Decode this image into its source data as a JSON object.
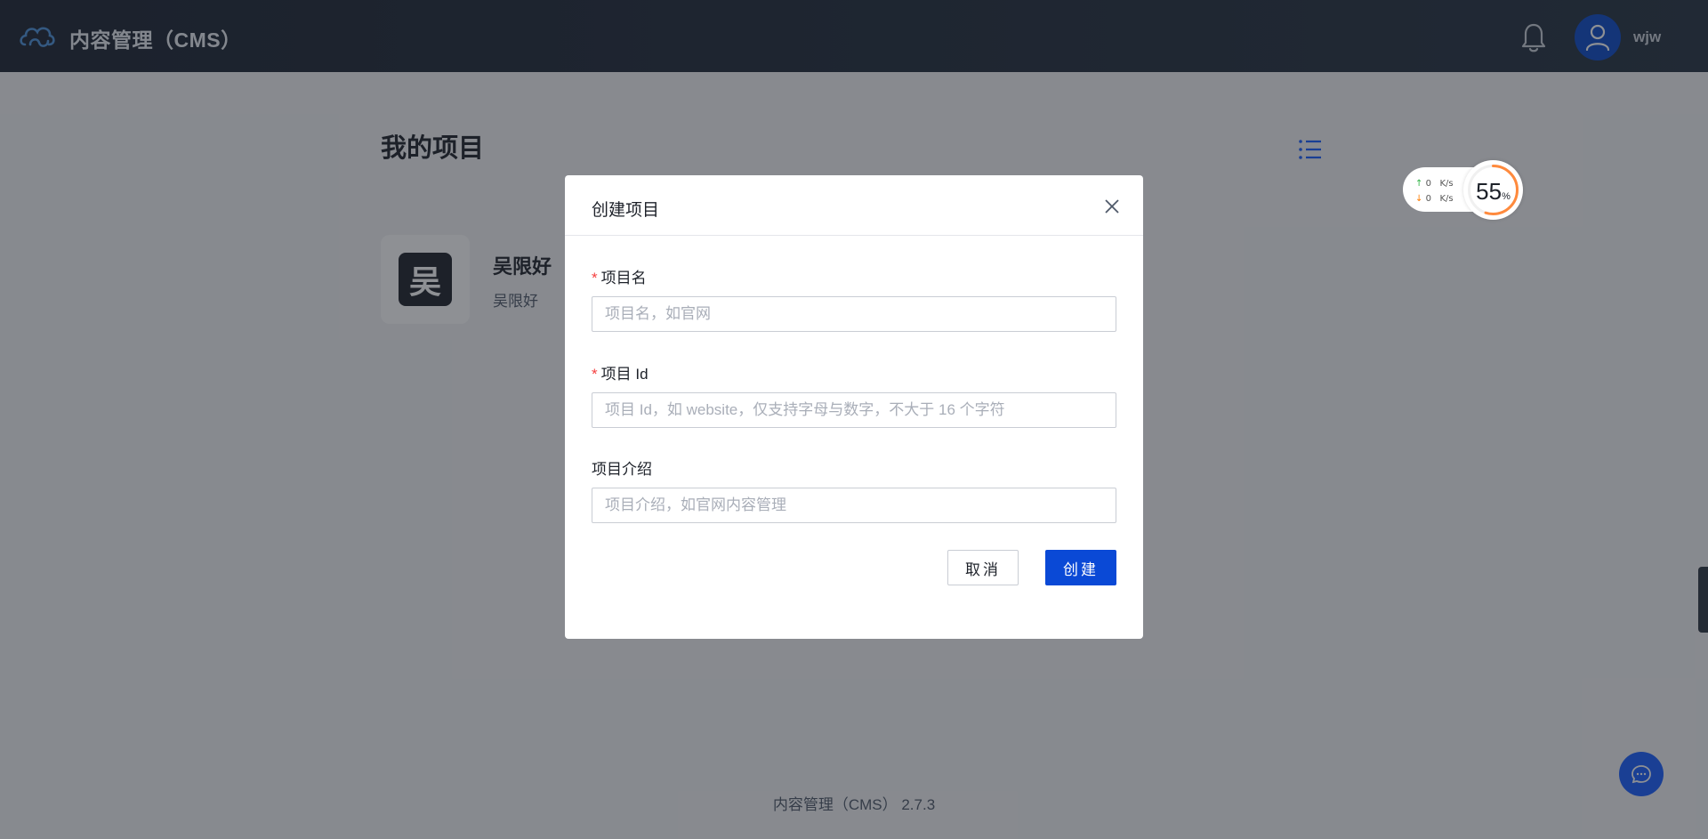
{
  "header": {
    "app_title": "内容管理（CMS）",
    "username": "wjw"
  },
  "page": {
    "title": "我的项目"
  },
  "projects": [
    {
      "avatar_char": "吴",
      "name": "吴限好",
      "description": "吴限好"
    }
  ],
  "footer": {
    "text": "内容管理（CMS） 2.7.3"
  },
  "speed_widget": {
    "upload": "0",
    "download": "0",
    "unit": "K/s",
    "percent": "55",
    "percent_sign": "%"
  },
  "modal": {
    "title": "创建项目",
    "fields": [
      {
        "label": "项目名",
        "required": true,
        "placeholder": "项目名，如官网",
        "value": ""
      },
      {
        "label": "项目 Id",
        "required": true,
        "placeholder": "项目 Id，如 website，仅支持字母与数字，不大于 16 个字符",
        "value": ""
      },
      {
        "label": "项目介绍",
        "required": false,
        "placeholder": "项目介绍，如官网内容管理",
        "value": ""
      }
    ],
    "cancel_label": "取消",
    "create_label": "创建"
  },
  "colors": {
    "primary": "#0a49d6",
    "header_bg": "#1a2230",
    "required_star": "#f53f3f"
  }
}
